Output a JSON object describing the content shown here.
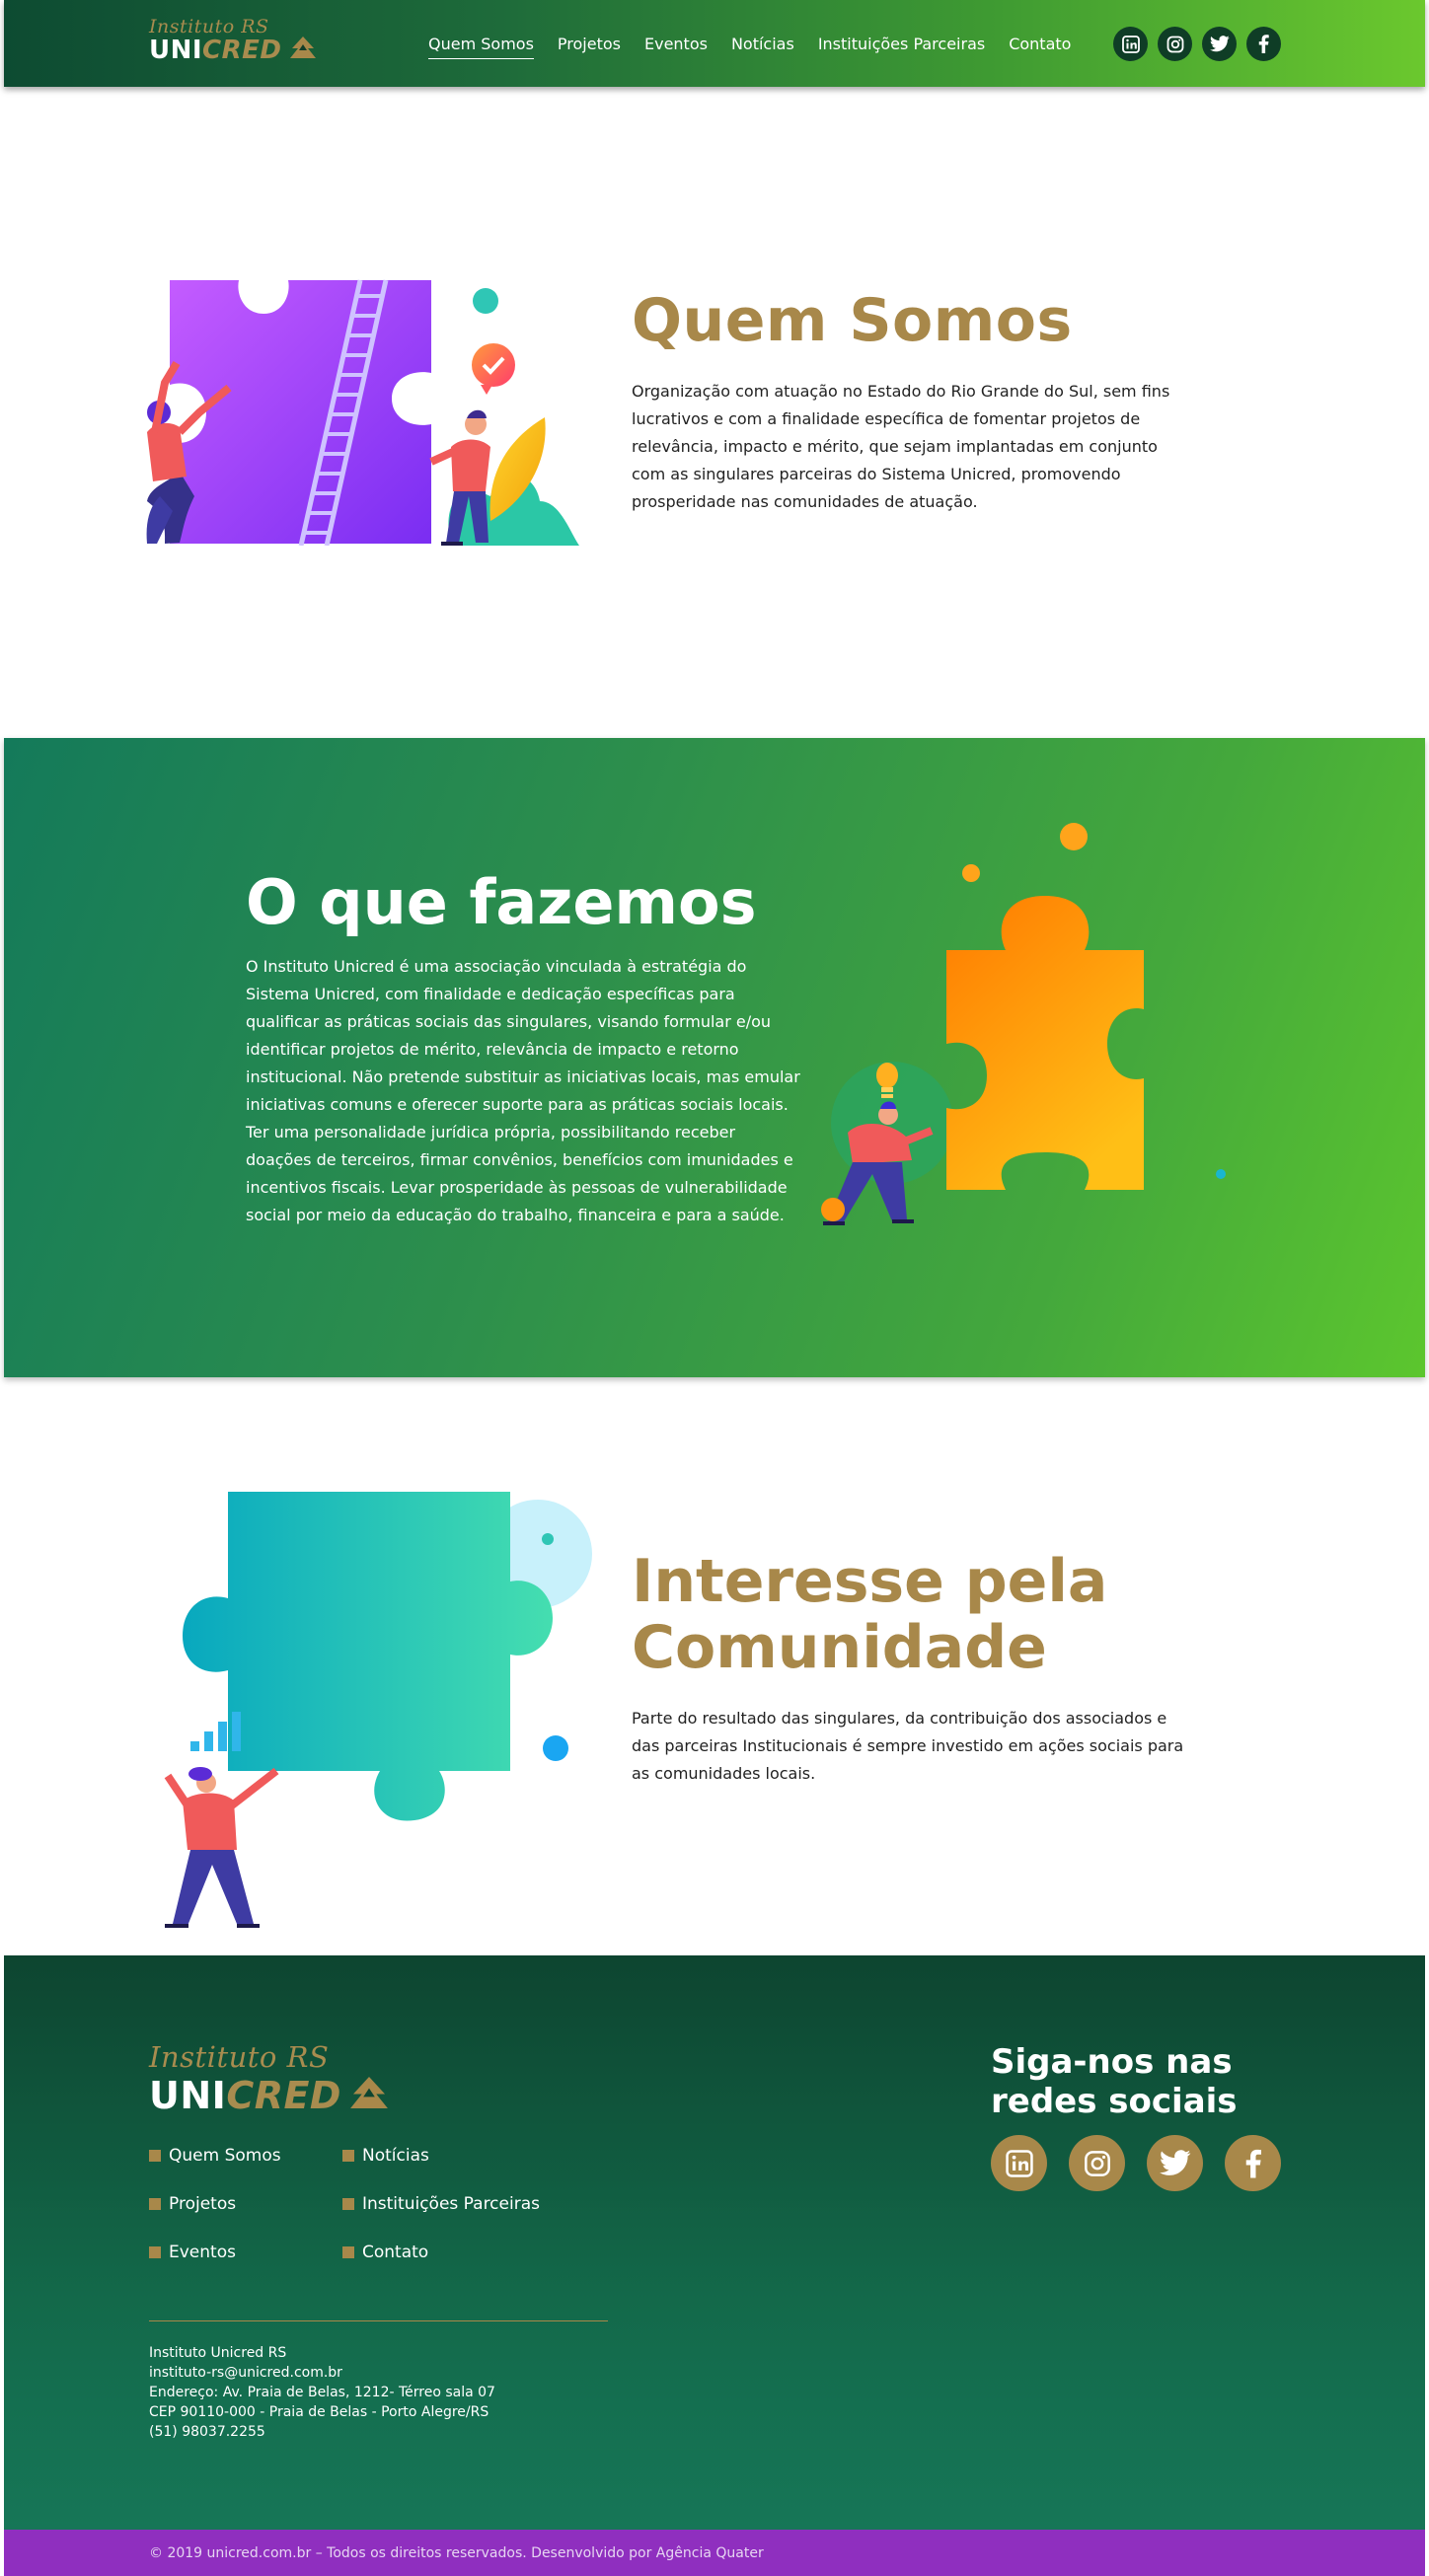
{
  "header": {
    "logo": {
      "script": "Instituto RS",
      "uni": "UNI",
      "cred": "CRED"
    },
    "nav": [
      {
        "label": "Quem Somos",
        "active": true
      },
      {
        "label": "Projetos"
      },
      {
        "label": "Eventos"
      },
      {
        "label": "Notícias"
      },
      {
        "label": "Instituições Parceiras"
      },
      {
        "label": "Contato"
      }
    ],
    "social": [
      "linkedin-icon",
      "instagram-icon",
      "twitter-icon",
      "facebook-icon"
    ]
  },
  "quem_somos": {
    "title": "Quem Somos",
    "text": "Organização com atuação no Estado do Rio Grande do Sul, sem fins lucrativos e com a finalidade específica de fomentar projetos de relevância, impacto e mérito, que sejam implantadas em conjunto com as singulares parceiras do Sistema Unicred, promovendo prosperidade nas comunidades de atuação."
  },
  "o_que_fazemos": {
    "title": "O que fazemos",
    "text": "O Instituto Unicred é uma associação vinculada à estratégia do Sistema Unicred, com finalidade e dedicação específicas para qualificar as práticas sociais das singulares, visando formular e/ou identificar projetos de mérito, relevância de impacto e retorno institucional. Não pretende substituir as iniciativas locais, mas emular iniciativas comuns e oferecer suporte para as práticas sociais locais. Ter uma personalidade jurídica própria, possibilitando receber doações de terceiros, firmar convênios, benefícios com imunidades e incentivos fiscais. Levar prosperidade às pessoas de vulnerabilidade social por meio da educação do trabalho, financeira e para a saúde."
  },
  "interesse": {
    "title": "Interesse pela Comunidade",
    "text": "Parte do resultado das singulares, da contribuição dos associados e das parceiras Institucionais é sempre investido em ações sociais para as comunidades locais."
  },
  "footer": {
    "logo": {
      "script": "Instituto RS",
      "uni": "UNI",
      "cred": "CRED"
    },
    "links": [
      "Quem Somos",
      "Notícias",
      "Projetos",
      "Instituições Parceiras",
      "Eventos",
      "Contato"
    ],
    "address": {
      "name": "Instituto Unicred RS",
      "email": "instituto-rs@unicred.com.br",
      "street": "Endereço: Av. Praia de Belas, 1212- Térreo sala 07",
      "cep": "CEP 90110-000 - Praia de Belas - Porto Alegre/RS",
      "phone": "(51) 98037.2255"
    },
    "follow_title": "Siga-nos nas redes sociais",
    "social": [
      "linkedin-icon",
      "instagram-icon",
      "twitter-icon",
      "facebook-icon"
    ]
  },
  "copyright": "© 2019 unicred.com.br – Todos os direitos reservados. Desenvolvido por Agência Quater",
  "colors": {
    "gold": "#a8884a",
    "header_dark": "#0d4b32",
    "header_light": "#6bc82e",
    "footer": "#13694a",
    "copyright_bar": "#8f2fbf"
  }
}
